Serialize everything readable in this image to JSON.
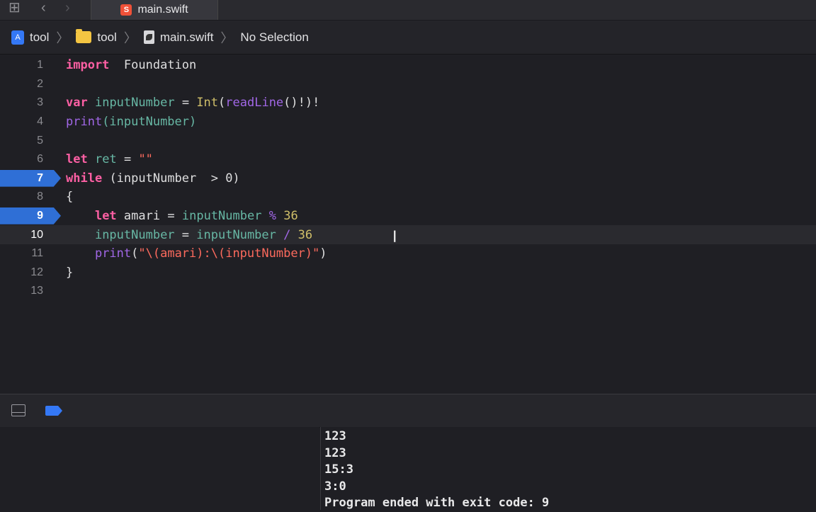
{
  "tab": {
    "label": "main.swift"
  },
  "jumpbar": {
    "project": "tool",
    "folder": "tool",
    "file": "main.swift",
    "selection": "No Selection"
  },
  "editor": {
    "current_line": 10,
    "breakpoints": [
      7,
      9
    ],
    "lines": [
      {
        "num": "1"
      },
      {
        "num": "2"
      },
      {
        "num": "3"
      },
      {
        "num": "4"
      },
      {
        "num": "5"
      },
      {
        "num": "6"
      },
      {
        "num": "7"
      },
      {
        "num": "8"
      },
      {
        "num": "9"
      },
      {
        "num": "10"
      },
      {
        "num": "11"
      },
      {
        "num": "12"
      },
      {
        "num": "13"
      }
    ],
    "code": {
      "l1": [
        "import",
        "Foundation"
      ],
      "l3": [
        "var",
        "inputNumber",
        "=",
        "Int",
        "(",
        "readLine",
        "()!)!"
      ],
      "l4": [
        "print",
        "(inputNumber)"
      ],
      "l6": [
        "let",
        "ret",
        "=",
        "\"\""
      ],
      "l7": [
        "while",
        "(inputNumber  > 0)"
      ],
      "l8": [
        "{"
      ],
      "l9": [
        "let",
        "amari",
        "=",
        "inputNumber",
        "%",
        "36"
      ],
      "l10": [
        "inputNumber",
        "=",
        "inputNumber",
        "/",
        "36"
      ],
      "l11": [
        "print",
        "(",
        "\"\\(amari):\\(inputNumber)\"",
        ")"
      ],
      "l12": [
        "}"
      ]
    }
  },
  "console": {
    "lines": [
      "123",
      "123",
      "15:3",
      "3:0",
      "Program ended with exit code: 9"
    ]
  },
  "colors": {
    "keyword": "#fc5fa3",
    "identifier": "#67b7a4",
    "function": "#a167e6",
    "number": "#d0bf69",
    "string": "#fc6a5d",
    "breakpoint": "#2f6fd6"
  }
}
